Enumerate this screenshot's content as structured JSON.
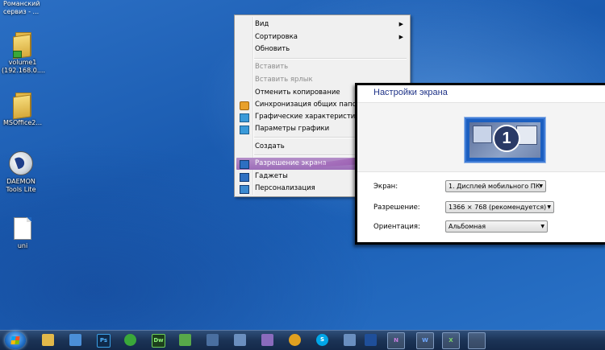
{
  "top_text": "Романский сервиз - ...",
  "desktop_icons": [
    {
      "label": "volume1 (192.168.0...."
    },
    {
      "label": "MSOffice2..."
    },
    {
      "label": "DAEMON Tools Lite"
    },
    {
      "label": "uni"
    }
  ],
  "context_menu": {
    "items": [
      {
        "label": "Вид",
        "submenu": true
      },
      {
        "label": "Сортировка",
        "submenu": true
      },
      {
        "label": "Обновить"
      },
      {
        "label": "Вставить",
        "disabled": true
      },
      {
        "label": "Вставить ярлык",
        "disabled": true
      },
      {
        "label": "Отменить копирование"
      },
      {
        "label": "Синхронизация общих папок",
        "icon": "sync-icon"
      },
      {
        "label": "Графические характеристики...",
        "icon": "graphics-icon"
      },
      {
        "label": "Параметры графики",
        "icon": "graphics-icon",
        "submenu": true
      },
      {
        "label": "Создать",
        "submenu": true
      },
      {
        "label": "Разрешение экрана",
        "icon": "display-icon",
        "highlighted": true
      },
      {
        "label": "Гаджеты",
        "icon": "gadgets-icon"
      },
      {
        "label": "Персонализация",
        "icon": "personalize-icon"
      }
    ]
  },
  "screen_settings": {
    "title": "Настройки экрана",
    "monitor_number": "1",
    "fields": [
      {
        "label": "Экран:",
        "value": "1. Дисплей мобильного ПК"
      },
      {
        "label": "Разрешение:",
        "value": "1366 × 768 (рекомендуется)"
      },
      {
        "label": "Ориентация:",
        "value": "Альбомная"
      }
    ]
  },
  "colors": {
    "highlight": "#9c6cb8",
    "arrow": "#8e3a9e",
    "desktop": "#1f5fb3",
    "panel_title": "#1e3287"
  },
  "taskbar": {
    "apps": [
      {
        "icon": "explorer-icon",
        "text": ""
      },
      {
        "icon": "remote-icon",
        "text": ""
      },
      {
        "icon": "photoshop-icon",
        "text": "Ps"
      },
      {
        "icon": "browser-icon",
        "text": ""
      },
      {
        "icon": "dreamweaver-icon",
        "text": "Dw"
      },
      {
        "icon": "app-icon",
        "text": ""
      },
      {
        "icon": "app-icon",
        "text": ""
      },
      {
        "icon": "app-icon",
        "text": ""
      },
      {
        "icon": "app-icon",
        "text": ""
      },
      {
        "icon": "app-icon",
        "text": ""
      },
      {
        "icon": "skype-icon",
        "text": "S"
      },
      {
        "icon": "app-icon",
        "text": ""
      },
      {
        "icon": "onenote-icon",
        "text": "N"
      },
      {
        "icon": "word-icon",
        "text": "W"
      },
      {
        "icon": "excel-icon",
        "text": "X"
      },
      {
        "icon": "settings-icon",
        "text": ""
      }
    ]
  }
}
